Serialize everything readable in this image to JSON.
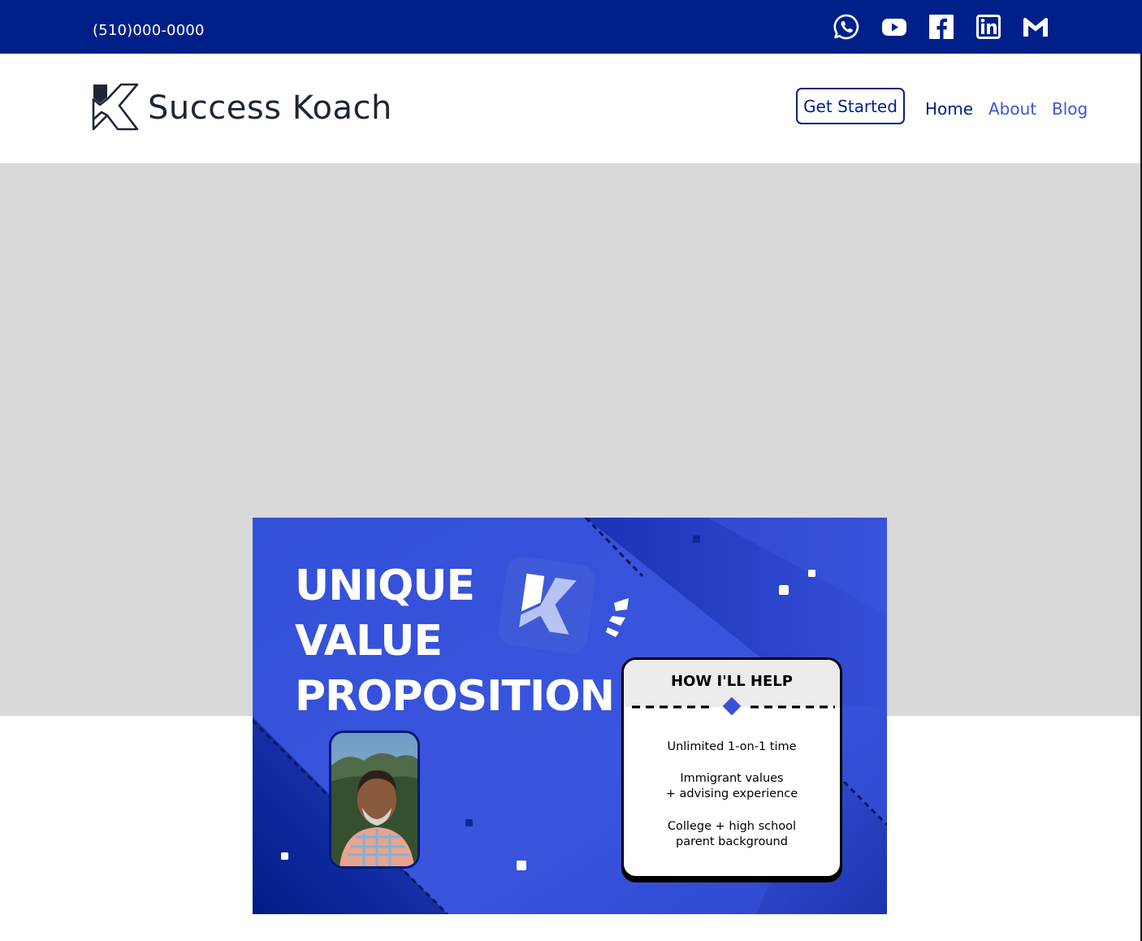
{
  "topbar": {
    "phone": "(510)000-0000",
    "social": [
      {
        "name": "whatsapp-icon"
      },
      {
        "name": "youtube-icon"
      },
      {
        "name": "facebook-icon"
      },
      {
        "name": "linkedin-icon"
      },
      {
        "name": "gmail-icon"
      }
    ]
  },
  "header": {
    "brand": "Success Koach",
    "cta_label": "Get Started",
    "nav": [
      {
        "label": "Home"
      },
      {
        "label": "About"
      },
      {
        "label": "Blog"
      }
    ]
  },
  "card": {
    "title_lines": [
      "UNIQUE",
      "VALUE",
      "PROPOSITION"
    ],
    "help_title": "HOW I'LL HELP",
    "help_items": [
      "Unlimited 1-on-1 time",
      "Immigrant values\n+ advising experience",
      "College + high school\nparent background"
    ]
  },
  "colors": {
    "topbar": "#002089",
    "hero_placeholder": "#d9d9d9",
    "card_blue": "#3a52d9",
    "nav_active": "#002089",
    "nav_link": "#3f53d5"
  }
}
